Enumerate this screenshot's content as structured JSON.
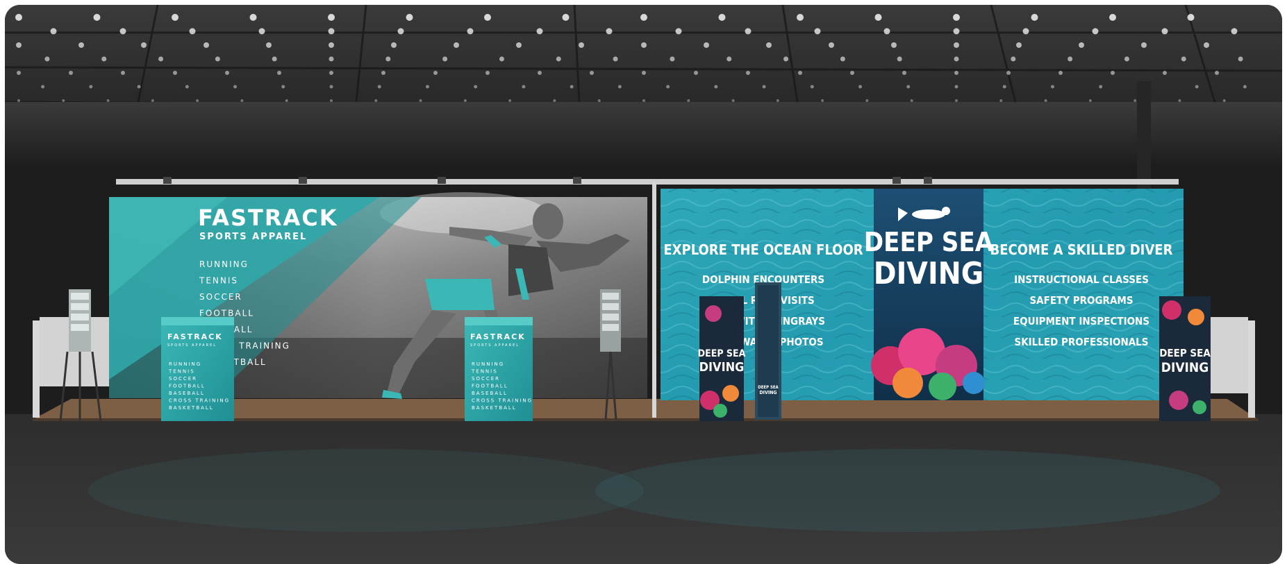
{
  "left_booth": {
    "brand_name": "FASTRACK",
    "brand_tagline": "SPORTS APPAREL",
    "sports": [
      "RUNNING",
      "TENNIS",
      "SOCCER",
      "FOOTBALL",
      "BASEBALL",
      "CROSS TRAINING",
      "BASKETBALL"
    ],
    "counter_brand": "FASTRACK",
    "counter_tagline": "SPORTS APPAREL",
    "counter_items": [
      "RUNNING",
      "TENNIS",
      "SOCCER",
      "FOOTBALL",
      "BASEBALL",
      "CROSS TRAINING",
      "BASKETBALL"
    ]
  },
  "right_booth": {
    "left_heading": "EXPLORE THE OCEAN FLOOR",
    "left_items": [
      "DOLPHIN ENCOUNTERS",
      "CORAL REEF VISITS",
      "SWIM WITH STINGRAYS",
      "UNDERWATER PHOTOS"
    ],
    "center_title_line1": "DEEP SEA",
    "center_title_line2": "DIVING",
    "right_heading": "BECOME A SKILLED DIVER",
    "right_items": [
      "INSTRUCTIONAL CLASSES",
      "SAFETY PROGRAMS",
      "EQUIPMENT INSPECTIONS",
      "SKILLED PROFESSIONALS"
    ],
    "tower_line1": "DEEP SEA",
    "tower_line2": "DIVING",
    "kiosk_line1": "DEEP SEA",
    "kiosk_line2": "DIVING"
  },
  "colors": {
    "teal": "#2fa6a8",
    "ocean": "#2aa3b5",
    "navy": "#143f5e",
    "floor": "#8a6a4e",
    "ceiling": "#2c2c2c"
  }
}
